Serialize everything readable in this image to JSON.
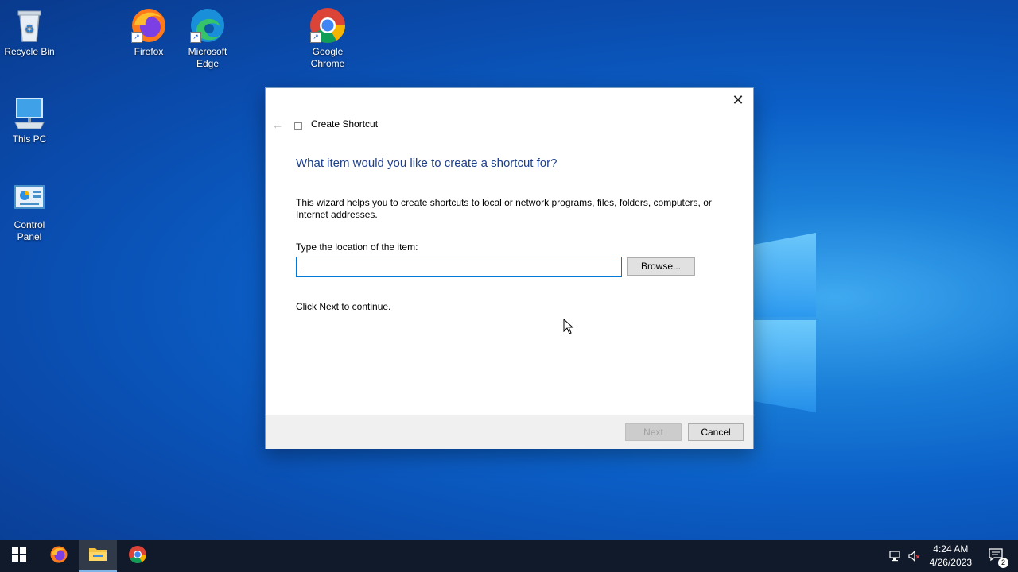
{
  "desktop": {
    "icons": [
      {
        "label": "Recycle Bin"
      },
      {
        "label": "Firefox"
      },
      {
        "label": "Microsoft Edge"
      },
      {
        "label": "Google Chrome"
      },
      {
        "label": "This PC"
      },
      {
        "label": "Control Panel"
      }
    ]
  },
  "dialog": {
    "title": "Create Shortcut",
    "close_label": "✕",
    "back_label": "←",
    "heading": "What item would you like to create a shortcut for?",
    "description": "This wizard helps you to create shortcuts to local or network programs, files, folders, computers, or Internet addresses.",
    "location_label": "Type the location of the item:",
    "location_value": "",
    "browse_label": "Browse...",
    "hint": "Click Next to continue.",
    "next_label": "Next",
    "cancel_label": "Cancel"
  },
  "taskbar": {
    "apps": [
      "start-icon",
      "firefox-icon",
      "file-explorer-icon",
      "chrome-icon"
    ],
    "active_app": "file-explorer-icon",
    "clock": {
      "time": "4:24 AM",
      "date": "4/26/2023"
    },
    "notification_count": "2"
  },
  "colors": {
    "accent": "#0078d7",
    "heading": "#1e3f8a",
    "taskbar": "#101a2a"
  }
}
